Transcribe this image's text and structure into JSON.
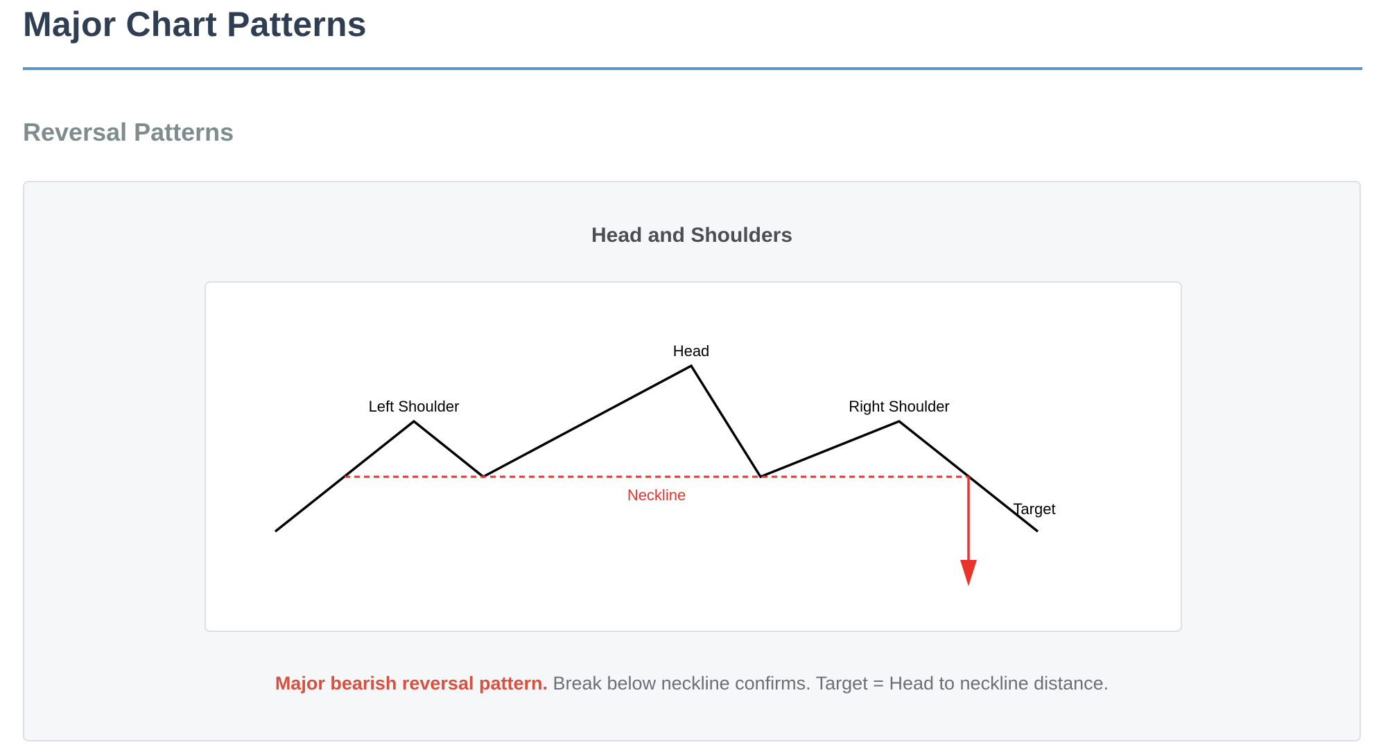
{
  "page": {
    "title": "Major Chart Patterns",
    "section_title": "Reversal Patterns"
  },
  "pattern": {
    "title": "Head and Shoulders",
    "description_emphasis": "Major bearish reversal pattern.",
    "description_rest": " Break below neckline confirms. Target = Head to neckline distance."
  },
  "diagram": {
    "labels": {
      "left_shoulder": "Left Shoulder",
      "head": "Head",
      "right_shoulder": "Right Shoulder",
      "neckline": "Neckline",
      "target": "Target"
    },
    "colors": {
      "price_line": "#000000",
      "neckline": "#e8342b",
      "target_arrow": "#e8342b"
    }
  }
}
